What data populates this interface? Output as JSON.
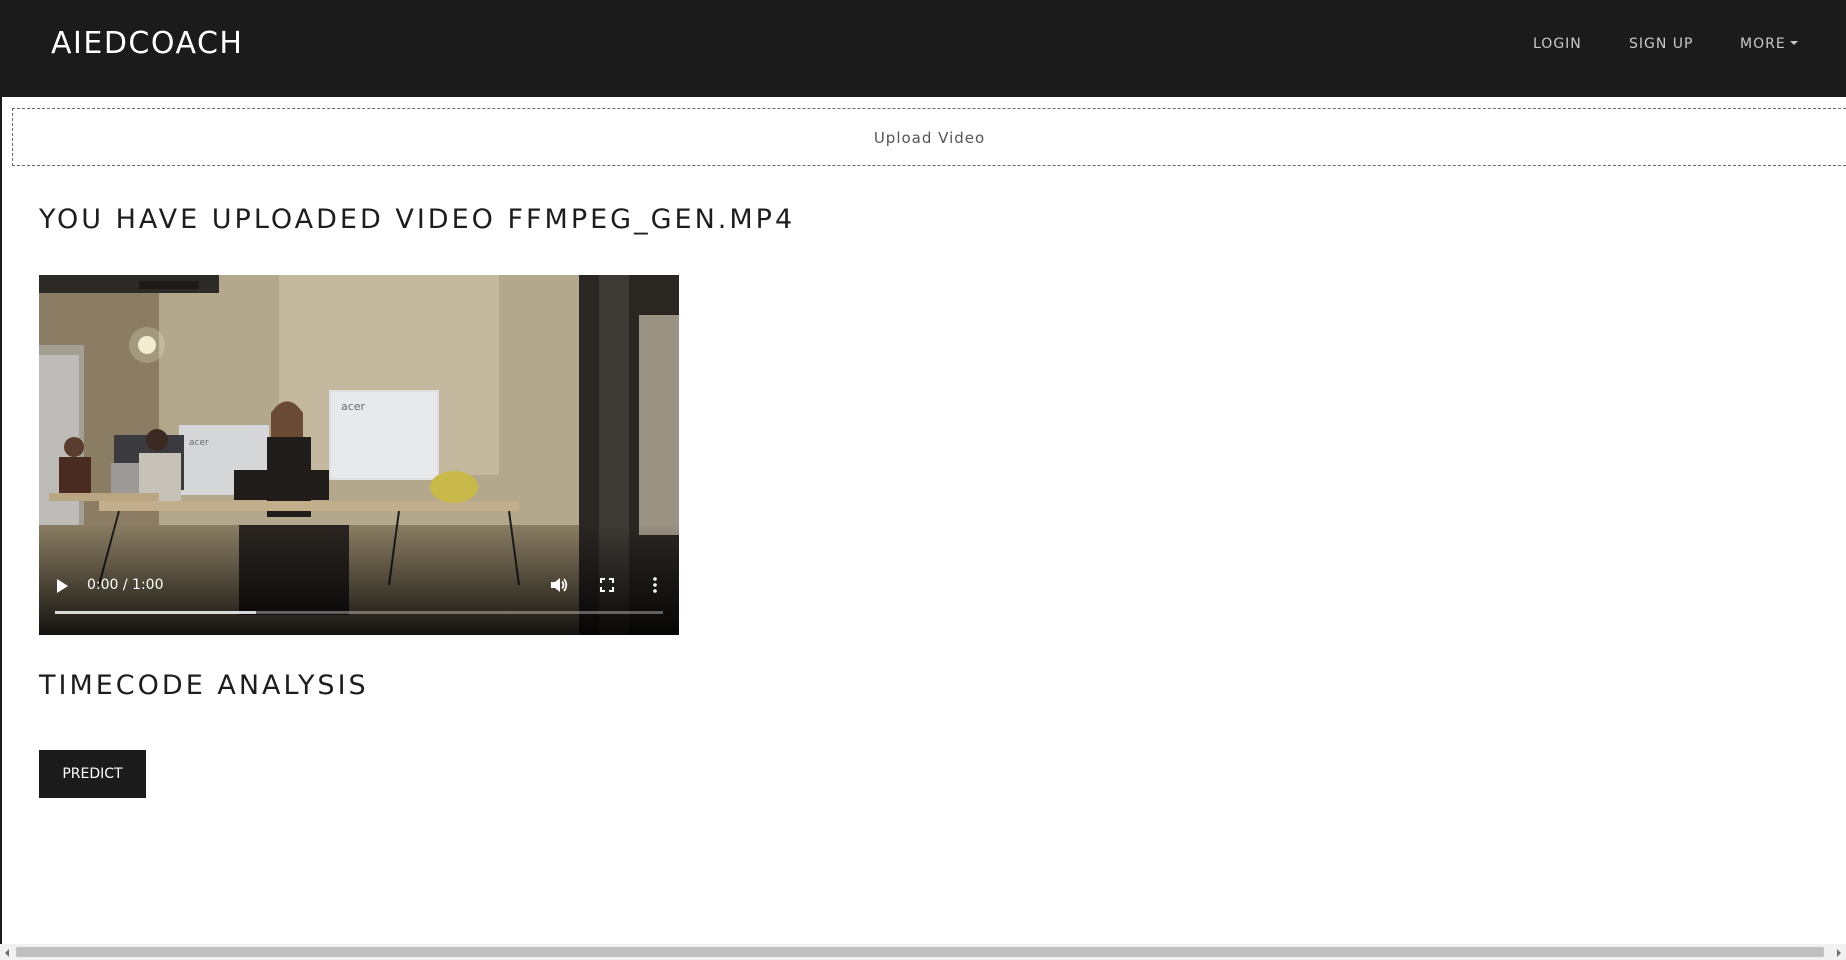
{
  "navbar": {
    "brand": "AIEDCOACH",
    "links": {
      "login": "LOGIN",
      "signup": "SIGN UP",
      "more": "MORE"
    }
  },
  "upload": {
    "label": "Upload Video"
  },
  "main": {
    "uploaded_heading": "YOU HAVE UPLOADED VIDEO FFMPEG_GEN.MP4",
    "analysis_heading": "TIMECODE ANALYSIS",
    "predict_label": "PREDICT"
  },
  "video": {
    "time_display": "0:00 / 1:00",
    "current_time": "0:00",
    "duration": "1:00",
    "buffered_fraction": 0.33,
    "icons": {
      "play": "play-icon",
      "volume": "volume-icon",
      "fullscreen": "fullscreen-icon",
      "more": "more-vertical-icon"
    },
    "monitor_text": "acer"
  },
  "colors": {
    "navbar_bg": "#1b1b1b",
    "button_bg": "#1b1b1b",
    "nav_text": "#c9c9c9"
  }
}
